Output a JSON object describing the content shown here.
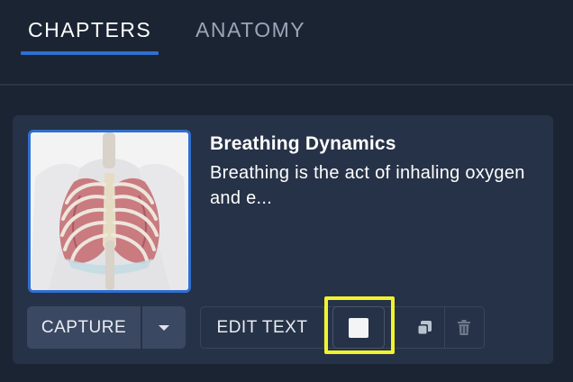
{
  "tabs": [
    {
      "label": "CHAPTERS",
      "active": true
    },
    {
      "label": "ANATOMY",
      "active": false
    }
  ],
  "chapter": {
    "title": "Breathing Dynamics",
    "description": "Breathing is the act of inhaling oxygen and e...",
    "thumbnail_icon": "ribcage-lungs-illustration"
  },
  "actions": {
    "capture_label": "CAPTURE",
    "capture_dropdown_icon": "caret-down-icon",
    "edit_text_label": "EDIT TEXT",
    "color_swatch": "#f4f4f6",
    "duplicate_icon": "duplicate-icon",
    "delete_icon": "trash-icon"
  },
  "colors": {
    "background": "#1b2433",
    "card": "#263247",
    "accent": "#2f6fd1",
    "highlight": "#f2f22e"
  }
}
